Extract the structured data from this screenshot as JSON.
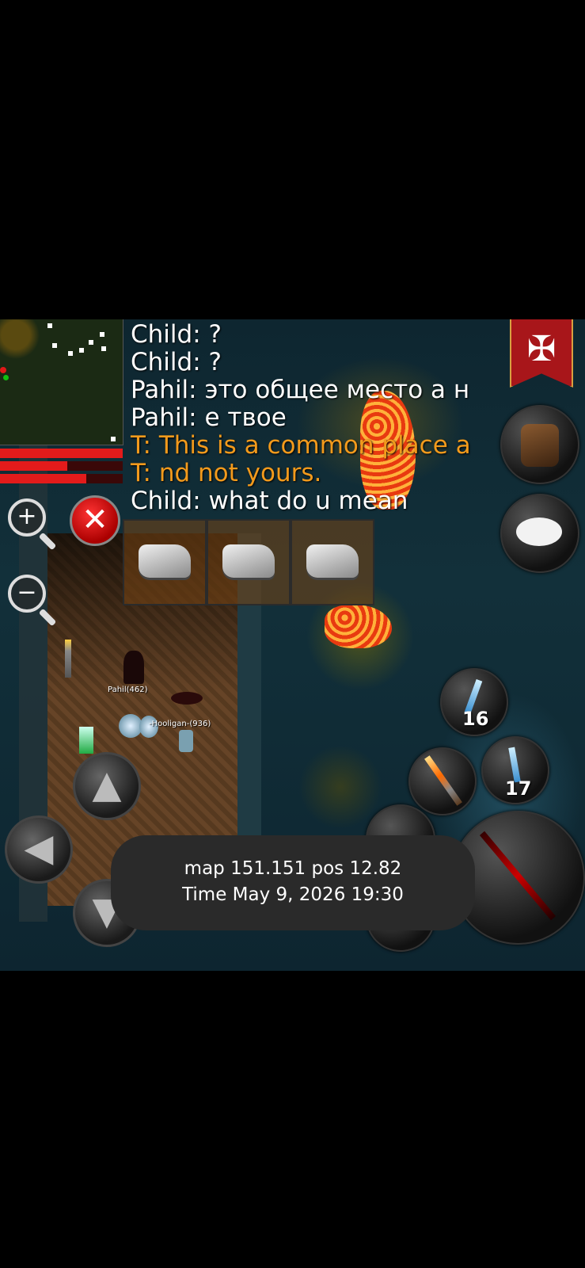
{
  "chat": {
    "lines": [
      {
        "text": "Child: ?",
        "color": "white"
      },
      {
        "text": "Child: ?",
        "color": "white"
      },
      {
        "text": "Pahil: это общее место а н",
        "color": "white"
      },
      {
        "text": "Pahil: е твое",
        "color": "white"
      },
      {
        "text": "T: This is a common place a",
        "color": "orange"
      },
      {
        "text": "T: nd not yours.",
        "color": "orange"
      },
      {
        "text": "Child: what do u mean",
        "color": "white"
      }
    ]
  },
  "players": {
    "pahil_label": "Pahil(462)",
    "hooligan_label": "-Hooligan-(936)"
  },
  "skills": [
    {
      "icon": "sword-ice-icon",
      "count": "16"
    },
    {
      "icon": "sword-ice-icon",
      "count": "17"
    }
  ],
  "inventory": {
    "items": [
      "stone-icon",
      "stone-icon",
      "stone-icon"
    ]
  },
  "bars": {
    "health": 1.0,
    "mana": 0.55,
    "stamina": 0.7
  },
  "toast": {
    "line1": "map 151.151 pos 12.82",
    "line2": "Time May 9, 2026 19:30"
  },
  "icons": {
    "zoom_in": "+",
    "zoom_out": "−",
    "close": "✕",
    "guild_emblem": "✠",
    "up": "▲",
    "left": "◀",
    "down": "▼"
  },
  "colors": {
    "chat_white": "#ffffff",
    "chat_orange": "#f29a1c",
    "bar_red": "#e31b1b"
  }
}
